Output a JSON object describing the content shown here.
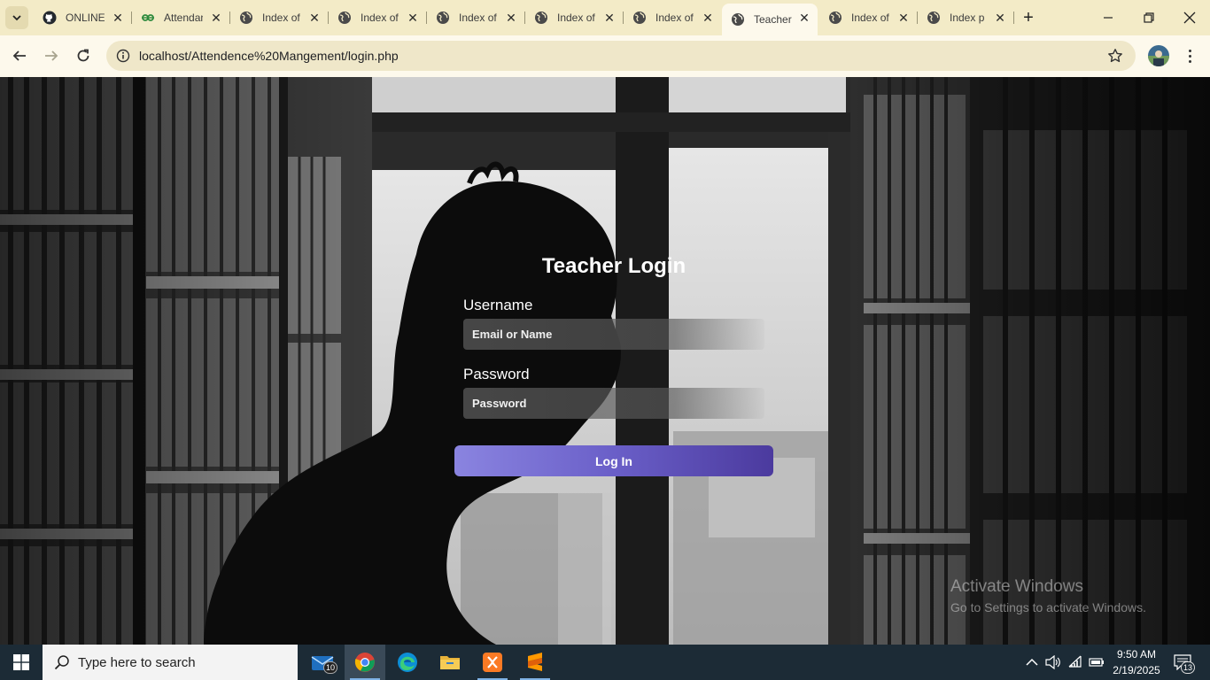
{
  "browser": {
    "tabs": [
      {
        "title": "ONLINE",
        "icon": "github-icon"
      },
      {
        "title": "Attendance",
        "icon": "link-icon"
      },
      {
        "title": "Index of",
        "icon": "globe-icon"
      },
      {
        "title": "Index of",
        "icon": "globe-icon"
      },
      {
        "title": "Index of",
        "icon": "globe-icon"
      },
      {
        "title": "Index of",
        "icon": "globe-icon"
      },
      {
        "title": "Index of",
        "icon": "globe-icon"
      },
      {
        "title": "Teacher",
        "icon": "globe-icon",
        "active": true
      },
      {
        "title": "Index of",
        "icon": "globe-icon"
      },
      {
        "title": "Index p",
        "icon": "globe-icon"
      }
    ],
    "tab_close_glyph": "✕",
    "new_tab_glyph": "+",
    "address": "localhost/Attendence%20Mangement/login.php",
    "theme_color": "#f3ebc7"
  },
  "login": {
    "title": "Teacher Login",
    "username_label": "Username",
    "username_placeholder": "Email or Name",
    "password_label": "Password",
    "password_placeholder": "Password",
    "submit_label": "Log In",
    "button_gradient": [
      "#8a84e0",
      "#4b3a9e"
    ]
  },
  "watermark": {
    "line1": "Activate Windows",
    "line2": "Go to Settings to activate Windows."
  },
  "taskbar": {
    "search_placeholder": "Type here to search",
    "apps": [
      {
        "name": "mail",
        "badge": "10"
      },
      {
        "name": "chrome",
        "active": true
      },
      {
        "name": "edge"
      },
      {
        "name": "file-explorer"
      },
      {
        "name": "xampp"
      },
      {
        "name": "sublime-text"
      }
    ],
    "time": "9:50 AM",
    "date": "2/19/2025",
    "notifications": "13"
  }
}
